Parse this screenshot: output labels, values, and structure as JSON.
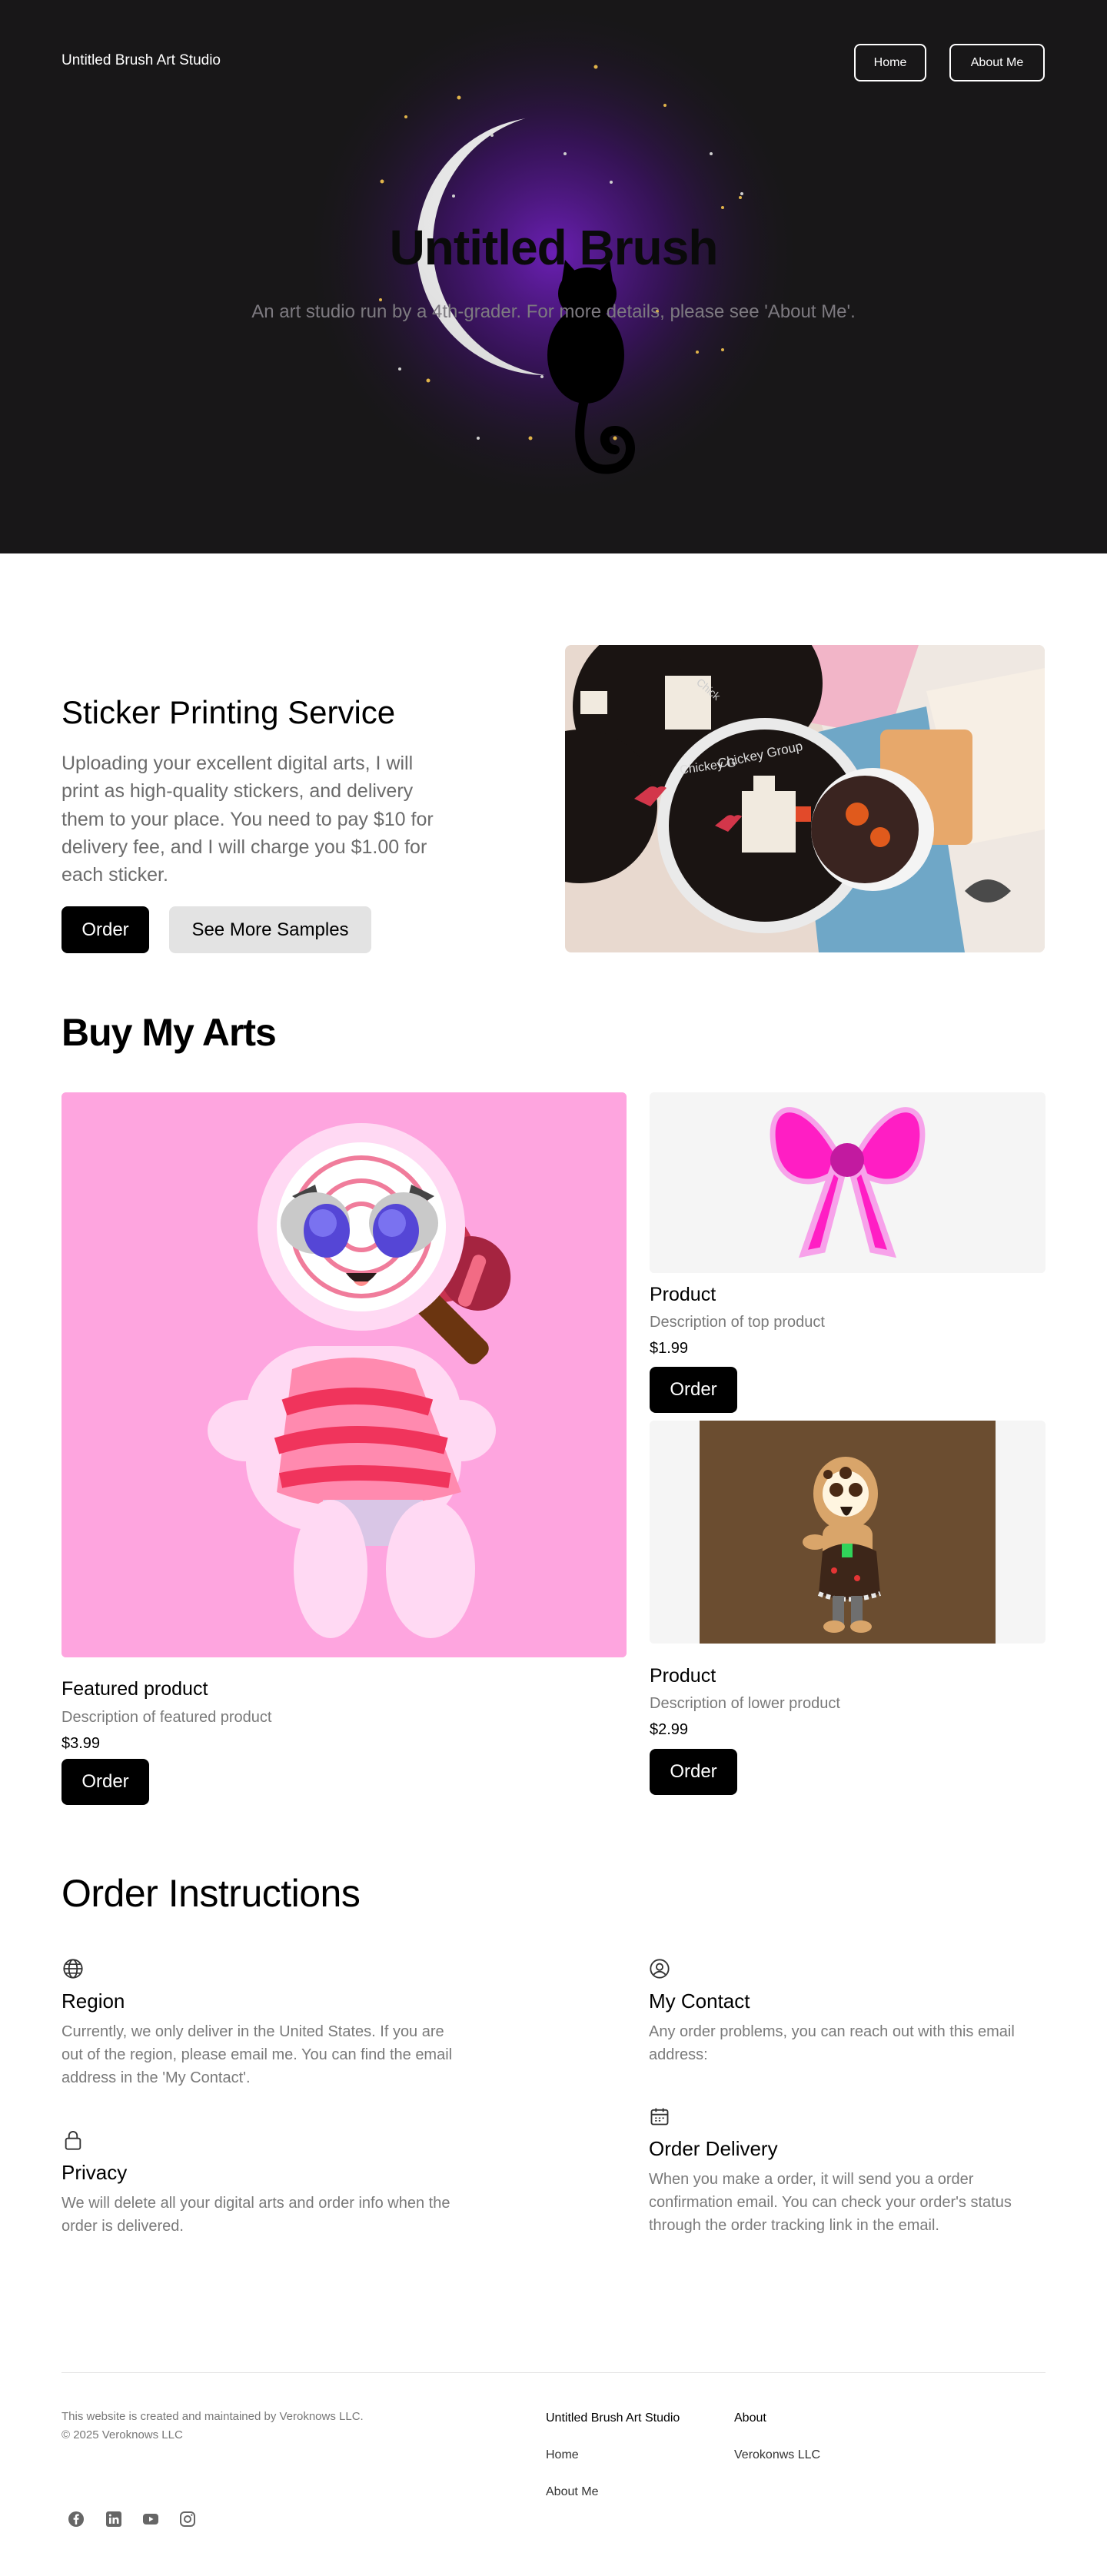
{
  "header": {
    "brand": "Untitled Brush Art Studio",
    "nav": {
      "home": "Home",
      "about": "About Me"
    }
  },
  "hero": {
    "title": "Untitled Brush",
    "subtitle": "An art studio run by a 4th-grader. For more details, please see 'About Me'."
  },
  "sticker": {
    "title": "Sticker Printing Service",
    "description": "Uploading your excellent digital arts, I will print as high-quality stickers, and delivery them to your place. You need to pay $10 for delivery fee, and I will charge you $1.00 for each sticker.",
    "order_label": "Order",
    "more_label": "See More Samples",
    "sticker_texts": [
      "Chickey Group",
      "Chickey G",
      "Chick"
    ]
  },
  "buy": {
    "title": "Buy My Arts",
    "featured": {
      "name": "Featured product",
      "description": "Description of featured product",
      "price": "$3.99",
      "order_label": "Order"
    },
    "top": {
      "name": "Product",
      "description": "Description of top product",
      "price": "$1.99",
      "order_label": "Order"
    },
    "lower": {
      "name": "Product",
      "description": "Description of lower product",
      "price": "$2.99",
      "order_label": "Order"
    }
  },
  "instructions": {
    "title": "Order Instructions",
    "region": {
      "icon": "globe-icon",
      "title": "Region",
      "text": "Currently, we only deliver in the United States. If you are out of the region, please email me. You can find the email address in the 'My Contact'."
    },
    "contact": {
      "icon": "user-circle-icon",
      "title": "My Contact",
      "text": "Any order problems, you can reach out with this email address:"
    },
    "privacy": {
      "icon": "lock-icon",
      "title": "Privacy",
      "text": "We will delete all your digital arts and order info when the order is delivered."
    },
    "delivery": {
      "icon": "calendar-icon",
      "title": "Order Delivery",
      "text": "When you make a order, it will send you a order confirmation email. You can check your order's status through the order tracking link in the email."
    }
  },
  "footer": {
    "credit": "This website is created and maintained by Veroknows LLC.",
    "copyright": "© 2025 Veroknows LLC",
    "col1": {
      "heading": "Untitled Brush Art Studio",
      "links": [
        "Home",
        "About Me"
      ]
    },
    "col2": {
      "heading": "About",
      "links": [
        "Verokonws LLC"
      ]
    },
    "social": [
      "facebook-icon",
      "linkedin-icon",
      "youtube-icon",
      "instagram-icon"
    ]
  }
}
